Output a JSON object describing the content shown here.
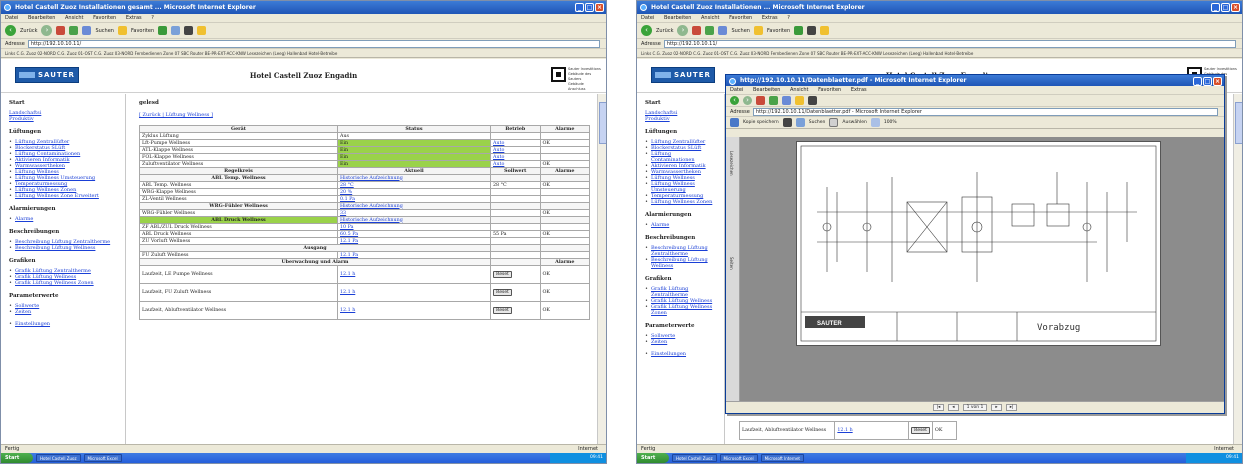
{
  "browser": {
    "left_title": "Hotel Castell Zuoz Installationen gesamt ... Microsoft Internet Explorer",
    "right_title": "Hotel Castell Zuoz Installationen ... Microsoft Internet Explorer",
    "menu": [
      "Datei",
      "Bearbeiten",
      "Ansicht",
      "Favoriten",
      "Extras",
      "?"
    ],
    "toolbar": {
      "back": "Zurück",
      "search": "Suchen",
      "favorites": "Favoriten"
    },
    "address_label": "Adresse",
    "address": "http://192.10.10.11/",
    "links": "Links  C.G. Zuoz 02-NORD  C.G. Zuoz 01-OST  C.G. Zuoz 03-NORD  Fernbedienen  Zone 07  SBC Router  BE-PR-EXT-ACC-KNW  Lesezeichen (Leeg)  Hallenbad  Hotel-Betreibe",
    "status_left": "Fertig",
    "status_right": "Internet",
    "taskbar": {
      "start": "Start",
      "left_items": [
        "Hotel Castell Zuoz",
        "Microsoft Excel"
      ],
      "right_items": [
        "Hotel Castell Zuoz",
        "Microsoft Excel",
        "Microsoft Internet"
      ],
      "clock": "09:41"
    }
  },
  "page": {
    "logo": "SAUTER",
    "title": "Hotel Castell Zuoz Engadin",
    "side_logo_lines": [
      "Sauter Investitions",
      "Gebäude des Sauters",
      "Gebäude Anschluss"
    ]
  },
  "nav": {
    "start_heading": "Start",
    "start_links": [
      "Landschaftsi",
      "Produktiv"
    ],
    "lueftungen_heading": "Lüftungen",
    "lueftungen": [
      "Lüftung Zentrallüfter",
      "Blockerstatus SLüft",
      "Lüftung Contaminationen",
      "Aktivieren Informatik",
      "Warmwassertheken",
      "Lüftung Wellness",
      "Lüftung Wellness Umsteuerung",
      "Temperaturmessung",
      "Lüftung Wellness Zonen",
      "Lüftung Wellness Zone Erweitert"
    ],
    "alarm_heading": "Alarmierungen",
    "alarm": [
      "Alarme"
    ],
    "beschreibungen_heading": "Beschreibungen",
    "beschreibungen": [
      "Beschreibung Lüftung Zentraltherme",
      "Beschreibung Lüftung Wellness"
    ],
    "grafiken_heading": "Grafiken",
    "grafiken": [
      "Grafik Lüftung Zentraltherme",
      "Grafik Lüftung Wellness",
      "Grafik Lüftung Wellness Zonen"
    ],
    "parameter_heading": "Parameterwerte",
    "parameter": [
      "Sollwerte",
      "Zeiten"
    ],
    "last_link": "Einstellungen"
  },
  "content": {
    "crumb": "gelesd",
    "crumb_link": "[ Zurück | Lüftung Wellness ]",
    "table_headers": [
      "Gerät",
      "Status",
      "Betrieb",
      "Alarme"
    ],
    "rows_top": [
      {
        "name": "Zyklus Lüftung",
        "status": "Aus",
        "green": false,
        "betrieb": "",
        "alarm": ""
      },
      {
        "name": "Lft-Pumpe Wellness",
        "status": "Ein",
        "green": true,
        "betrieb": "Auto",
        "alarm": "OK"
      },
      {
        "name": "ATL-Klappe Wellness",
        "status": "Ein",
        "green": true,
        "betrieb": "Auto",
        "alarm": ""
      },
      {
        "name": "FOL-Klappe Wellness",
        "status": "Ein",
        "green": true,
        "betrieb": "Auto",
        "alarm": ""
      },
      {
        "name": "Zuluftventilator Wellness",
        "status": "Ein",
        "green": true,
        "betrieb": "Auto",
        "alarm": "OK"
      }
    ],
    "regel_headers": [
      "Regelkreis",
      "Aktuell",
      "Sollwert",
      "Alarme"
    ],
    "sec_temp": "ABL Temp. Wellness",
    "sec_temp_link": "Historische Aufzeichnung",
    "rows_temp": [
      {
        "name": "ABL Temp. Wellness",
        "aktuell": "28 °C",
        "soll": "28 °C",
        "alarm": "OK"
      },
      {
        "name": "WRG-Klappe Wellness",
        "aktuell": "20 %",
        "soll": "",
        "alarm": ""
      },
      {
        "name": "ZL-Ventil Wellness",
        "aktuell": "0.1 Pa",
        "soll": "",
        "alarm": ""
      }
    ],
    "sec_wrg": "WRG-Fühler Wellness",
    "sec_wrg_link": "Historische Aufzeichnung",
    "rows_wrg": [
      {
        "name": "WRG-Fühler Wellness",
        "aktuell": "33",
        "soll": "",
        "alarm": "OK"
      }
    ],
    "sec_druck": "ABL Druck Wellness",
    "sec_druck_link": "Historische Aufzeichnung",
    "rows_druck": [
      {
        "name": "ZF ABL/ZUL Druck Wellness",
        "aktuell": "10 Pa",
        "soll": "",
        "alarm": ""
      },
      {
        "name": "ABL Druck Wellness",
        "aktuell": "60.5 Pa",
        "soll": "55 Pa",
        "alarm": "OK"
      },
      {
        "name": "ZU Vorluft Wellness",
        "aktuell": "12.1 Pa",
        "soll": "",
        "alarm": ""
      }
    ],
    "sec_ausgang": "Ausgang",
    "rows_ausgang": [
      {
        "name": "FU Zuluft Wellness",
        "aktuell": "12.1 Pa",
        "soll": "",
        "alarm": ""
      }
    ],
    "sec_ueberw": "Überwachung und Alarm",
    "sec_ueberw_alarm": "Alarme",
    "rows_ueberw": [
      {
        "name": "Laufzeit, LE Pumpe Wellness",
        "aktuell": "12.1 h",
        "btn": "Reset",
        "alarm": "OK"
      },
      {
        "name": "Laufzeit, FU Zuluft Wellness",
        "aktuell": "12.1 h",
        "btn": "Reset",
        "alarm": "OK"
      },
      {
        "name": "Laufzeit, Abluftventilator Wellness",
        "aktuell": "12.1 h",
        "btn": "Reset",
        "alarm": "OK"
      }
    ]
  },
  "popup": {
    "title": "http://192.10.10.11/Datenblaetter.pdf - Microsoft Internet Explorer",
    "pdf_tools": [
      "Kopie speichern",
      "Suchen",
      "Auswählen",
      "100%"
    ],
    "sidebar_tabs": [
      "Lesezeichen",
      "Seiten"
    ],
    "drawing_logo": "SAUTER",
    "drawing_stamp": "Vorabzug",
    "page_indicator": "1 von 1",
    "bottom_row_label": "Laufzeit, Abluftventilator Wellness",
    "bottom_row_value": "12.1 h"
  }
}
